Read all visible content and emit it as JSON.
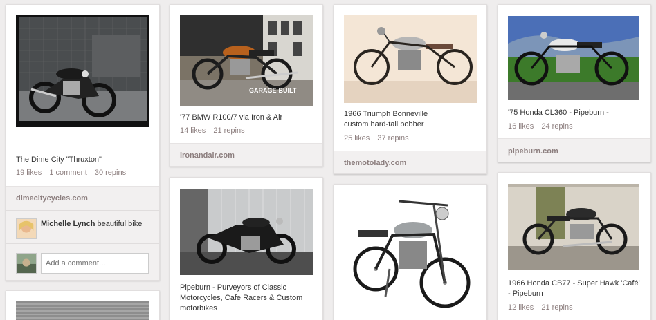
{
  "pins": [
    {
      "description": "The Dime City \"Thruxton\"",
      "likes": "19 likes",
      "comments": "1 comment",
      "repins": "30 repins",
      "source": "dimecitycycles.com",
      "comment": {
        "user": "Michelle Lynch",
        "text": "beautiful bike"
      },
      "add_comment_placeholder": "Add a comment..."
    },
    {
      "description": "'77 BMW R100/7 via Iron & Air",
      "likes": "14 likes",
      "repins": "21 repins",
      "source": "ironandair.com",
      "image_caption": "GARAGE-BUILT"
    },
    {
      "description": "1966 Triumph Bonneville custom hard-tail bobber",
      "likes": "25 likes",
      "repins": "37 repins",
      "source": "themotolady.com"
    },
    {
      "description": "'75 Honda CL360 - Pipeburn -",
      "likes": "16 likes",
      "repins": "24 repins",
      "source": "pipeburn.com"
    },
    {
      "description": "Pipeburn - Purveyors of Classic Motorcycles, Cafe Racers & Custom motorbikes"
    },
    {
      "description": ""
    },
    {
      "description": "1966 Honda CB77 - Super Hawk 'Café' - Pipeburn",
      "likes": "12 likes",
      "repins": "21 repins"
    }
  ]
}
